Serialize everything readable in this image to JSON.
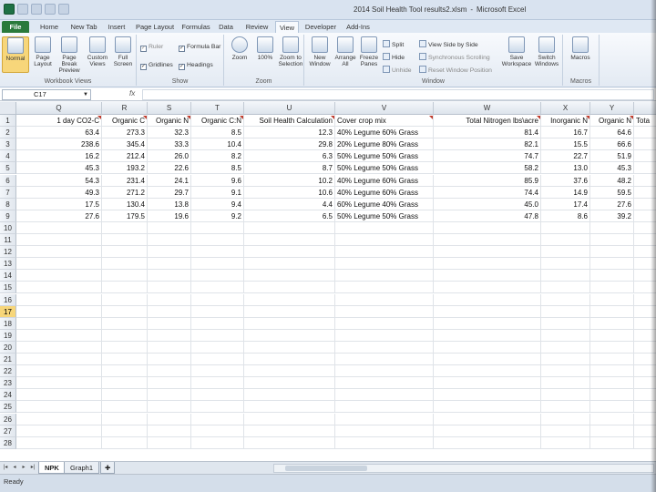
{
  "window": {
    "title": "2014 Soil Health Tool results2.xlsm",
    "app": "Microsoft Excel",
    "separator": "-"
  },
  "ribbon_tabs": [
    "File",
    "Home",
    "New Tab",
    "Insert",
    "Page Layout",
    "Formulas",
    "Data",
    "Review",
    "View",
    "Developer",
    "Add-Ins"
  ],
  "active_tab": "View",
  "ribbon": {
    "workbook_views": {
      "label": "Workbook Views",
      "normal": "Normal",
      "page_layout": "Page Layout",
      "page_break_preview": "Page Break Preview",
      "custom_views": "Custom Views",
      "full_screen": "Full Screen"
    },
    "show": {
      "label": "Show",
      "ruler": "Ruler",
      "formula_bar": "Formula Bar",
      "gridlines": "Gridlines",
      "headings": "Headings"
    },
    "zoom": {
      "label": "Zoom",
      "zoom": "Zoom",
      "hundred": "100%",
      "zoom_to_selection": "Zoom to Selection"
    },
    "window": {
      "label": "Window",
      "new_window": "New Window",
      "arrange_all": "Arrange All",
      "freeze_panes": "Freeze Panes",
      "split": "Split",
      "hide": "Hide",
      "unhide": "Unhide",
      "side_by_side": "View Side by Side",
      "sync_scroll": "Synchronous Scrolling",
      "reset_position": "Reset Window Position",
      "save_workspace": "Save Workspace",
      "switch_windows": "Switch Windows"
    },
    "macros": {
      "label": "Macros",
      "macros": "Macros"
    }
  },
  "formula_bar": {
    "name_box": "C17",
    "fx": "fx",
    "value": ""
  },
  "grid": {
    "columns": [
      "Q",
      "R",
      "S",
      "T",
      "U",
      "V",
      "W",
      "X",
      "Y"
    ],
    "header_row": [
      "1 day CO2-C",
      "Organic C",
      "Organic N",
      "Organic C:N",
      "Soil Health Calculation",
      "Cover crop mix",
      "Total Nitrogen lbs\\acre",
      "Inorganic N",
      "Organic N",
      "Tota"
    ],
    "row_numbers": [
      "1",
      "2",
      "3",
      "4",
      "5",
      "6",
      "7",
      "8",
      "9",
      "10",
      "11",
      "12",
      "13",
      "14",
      "15",
      "16",
      "17",
      "18",
      "19",
      "20",
      "21",
      "22",
      "23",
      "24",
      "25",
      "26",
      "27",
      "28"
    ],
    "selected_row": "17",
    "rows": [
      [
        "63.4",
        "273.3",
        "32.3",
        "8.5",
        "12.3",
        "40% Legume 60% Grass",
        "81.4",
        "16.7",
        "64.6"
      ],
      [
        "238.6",
        "345.4",
        "33.3",
        "10.4",
        "29.8",
        "20% Legume 80% Grass",
        "82.1",
        "15.5",
        "66.6"
      ],
      [
        "16.2",
        "212.4",
        "26.0",
        "8.2",
        "6.3",
        "50% Legume 50% Grass",
        "74.7",
        "22.7",
        "51.9"
      ],
      [
        "45.3",
        "193.2",
        "22.6",
        "8.5",
        "8.7",
        "50% Legume 50% Grass",
        "58.2",
        "13.0",
        "45.3"
      ],
      [
        "54.3",
        "231.4",
        "24.1",
        "9.6",
        "10.2",
        "40% Legume 60% Grass",
        "85.9",
        "37.6",
        "48.2"
      ],
      [
        "49.3",
        "271.2",
        "29.7",
        "9.1",
        "10.6",
        "40% Legume 60% Grass",
        "74.4",
        "14.9",
        "59.5"
      ],
      [
        "17.5",
        "130.4",
        "13.8",
        "9.4",
        "4.4",
        "60% Legume 40% Grass",
        "45.0",
        "17.4",
        "27.6"
      ],
      [
        "27.6",
        "179.5",
        "19.6",
        "9.2",
        "6.5",
        "50% Legume 50% Grass",
        "47.8",
        "8.6",
        "39.2"
      ]
    ]
  },
  "sheets": [
    "NPK",
    "Graph1"
  ],
  "active_sheet": "NPK",
  "status": "Ready"
}
